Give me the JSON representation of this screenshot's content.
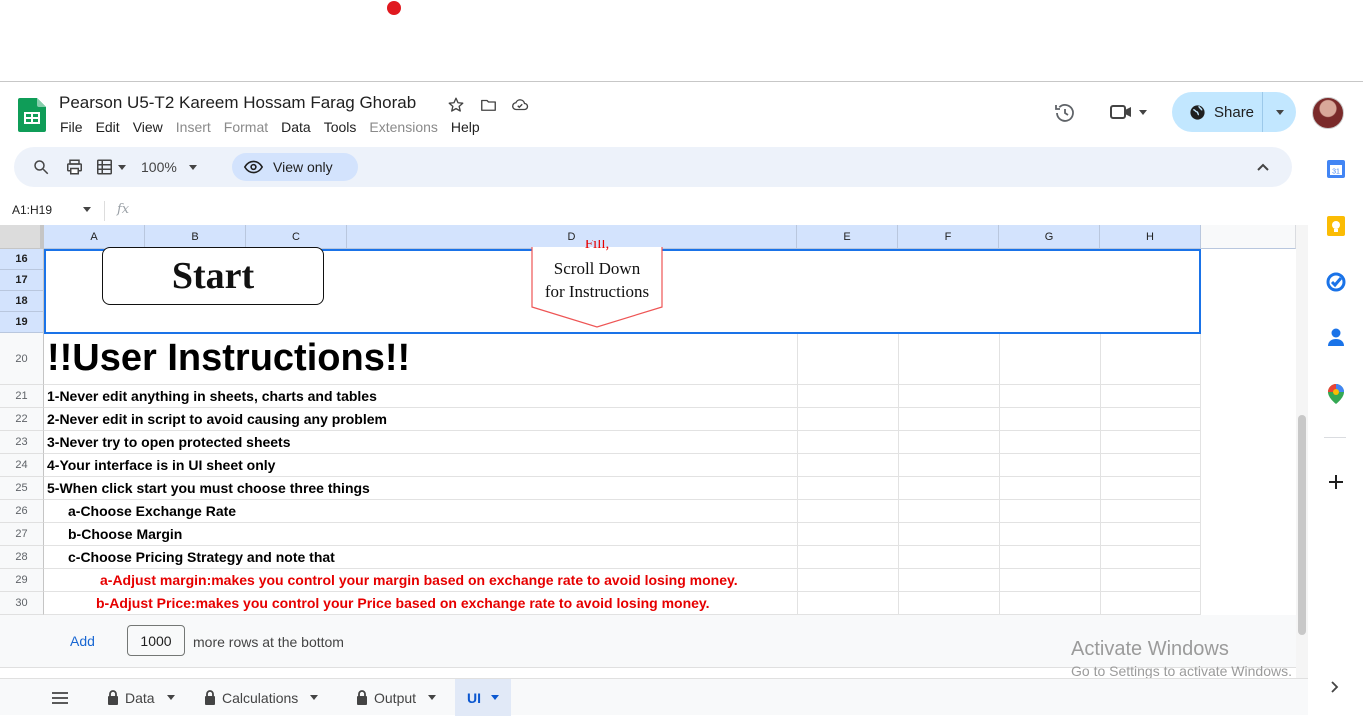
{
  "doc": {
    "title": "Pearson U5-T2 Kareem Hossam Farag Ghorab"
  },
  "menu": [
    {
      "label": "File",
      "enabled": true
    },
    {
      "label": "Edit",
      "enabled": true
    },
    {
      "label": "View",
      "enabled": true
    },
    {
      "label": "Insert",
      "enabled": false
    },
    {
      "label": "Format",
      "enabled": false
    },
    {
      "label": "Data",
      "enabled": true
    },
    {
      "label": "Tools",
      "enabled": true
    },
    {
      "label": "Extensions",
      "enabled": false
    },
    {
      "label": "Help",
      "enabled": true
    }
  ],
  "header": {
    "share_label": "Share"
  },
  "toolbar": {
    "zoom": "100%",
    "view_only": "View only"
  },
  "formula_bar": {
    "name_box": "A1:H19",
    "fx": "fx"
  },
  "columns": [
    "A",
    "B",
    "C",
    "D",
    "E",
    "F",
    "G",
    "H"
  ],
  "rows": {
    "selected": [
      "16",
      "17",
      "18",
      "19"
    ],
    "normal": [
      "20",
      "21",
      "22",
      "23",
      "24",
      "25",
      "26",
      "27",
      "28",
      "29",
      "30"
    ]
  },
  "drawings": {
    "start_button": "Start",
    "arrow_top": "Fill,",
    "arrow_line1": "Scroll Down",
    "arrow_line2": "for Instructions"
  },
  "instructions": {
    "title": "!!User Instructions!!",
    "lines": [
      {
        "text": "1-Never edit anything in sheets, charts and tables",
        "color": "#000000"
      },
      {
        "text": "2-Never edit in script to avoid causing any problem",
        "color": "#000000"
      },
      {
        "text": "3-Never try to open protected sheets",
        "color": "#000000"
      },
      {
        "text": "4-Your interface is in UI sheet only",
        "color": "#000000"
      },
      {
        "text": "5-When click start you must choose three things",
        "color": "#000000"
      },
      {
        "text": "a-Choose Exchange Rate",
        "color": "#000000"
      },
      {
        "text": "b-Choose Margin",
        "color": "#000000"
      },
      {
        "text": "c-Choose Pricing Strategy and note that",
        "color": "#000000"
      },
      {
        "text": "a-Adjust margin:makes you control your margin based on exchange rate to avoid losing money.",
        "color": "#e60000"
      },
      {
        "text": "b-Adjust Price:makes you control your Price based on exchange rate to avoid losing money.",
        "color": "#e60000"
      }
    ]
  },
  "add_rows": {
    "button": "Add",
    "count": "1000",
    "suffix": "more rows at the bottom"
  },
  "watermark": {
    "line1": "Activate Windows",
    "line2": "Go to Settings to activate Windows."
  },
  "sheets": [
    {
      "name": "Data",
      "locked": true,
      "active": false
    },
    {
      "name": "Calculations",
      "locked": true,
      "active": false
    },
    {
      "name": "Output",
      "locked": true,
      "active": false
    },
    {
      "name": "UI",
      "locked": false,
      "active": true
    }
  ],
  "side_apps": [
    "calendar-icon",
    "keep-icon",
    "tasks-icon",
    "contacts-icon",
    "maps-icon",
    "add-icon"
  ]
}
